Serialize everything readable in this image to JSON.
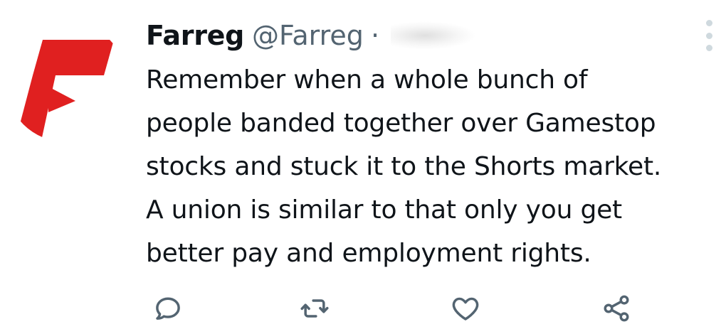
{
  "tweet": {
    "author": {
      "display_name": "Farreg",
      "handle": "@Farreg",
      "separator": "·",
      "avatar_icon": "red-f-logo-icon",
      "avatar_color": "#e02020"
    },
    "more_icon": "more-dots-vertical-icon",
    "text_lines": [
      "Remember when a whole bunch of",
      "people banded together over Gamestop",
      "stocks and stuck it to the Shorts market.",
      "A union is similar to that only you get",
      "better pay and employment rights."
    ],
    "actions": [
      {
        "icon": "reply-icon"
      },
      {
        "icon": "retweet-icon"
      },
      {
        "icon": "like-heart-icon"
      },
      {
        "icon": "share-icon"
      }
    ],
    "colors": {
      "text": "#0f1419",
      "secondary": "#536471",
      "icon": "#536471",
      "accent": "#e02020"
    }
  }
}
